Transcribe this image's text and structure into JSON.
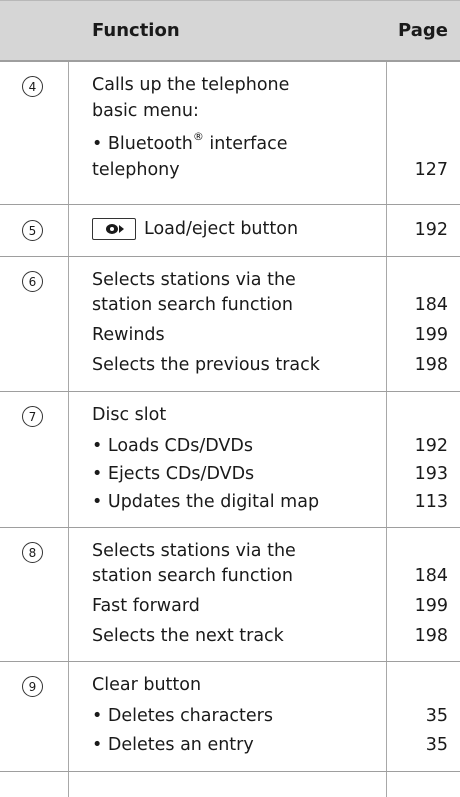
{
  "header": {
    "function": "Function",
    "page": "Page"
  },
  "rows": [
    {
      "num": "4",
      "lines": [
        "Calls up the telephone",
        "basic menu:",
        "• Bluetooth",
        "telephony"
      ],
      "bt_sup": "®",
      "bt_rest": " interface",
      "pages": [
        "127"
      ]
    },
    {
      "num": "5",
      "icon": "load-eject-button-icon",
      "label": "Load/eject button",
      "pages": [
        "192"
      ]
    },
    {
      "num": "6",
      "lines": [
        "Selects stations via the",
        "station search function",
        "Rewinds",
        "Selects the previous track"
      ],
      "pages": [
        "184",
        "199",
        "198"
      ]
    },
    {
      "num": "7",
      "lines": [
        "Disc slot",
        "• Loads CDs/DVDs",
        "• Ejects CDs/DVDs",
        "• Updates the digital map"
      ],
      "pages": [
        "192",
        "193",
        "113"
      ]
    },
    {
      "num": "8",
      "lines": [
        "Selects stations via the",
        "station search function",
        "Fast forward",
        "Selects the next track"
      ],
      "pages": [
        "184",
        "199",
        "198"
      ]
    },
    {
      "num": "9",
      "lines": [
        "Clear button",
        "• Deletes characters",
        "• Deletes an entry"
      ],
      "pages": [
        "35",
        "35"
      ]
    }
  ]
}
